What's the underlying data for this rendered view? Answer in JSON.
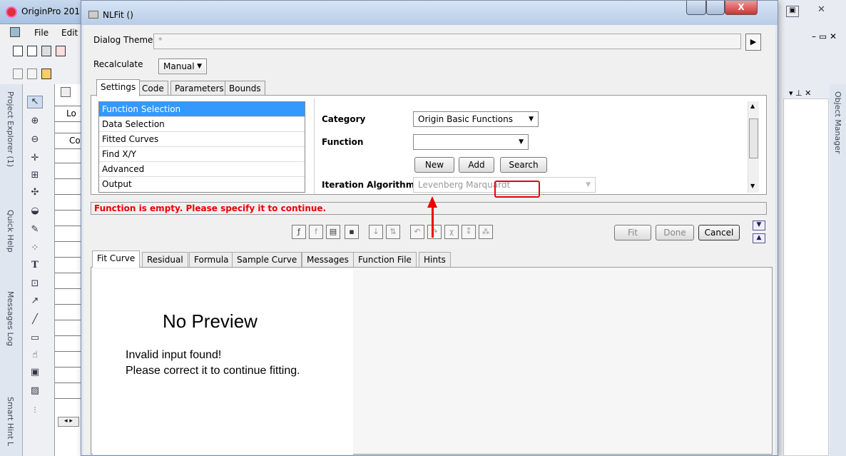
{
  "background_app": {
    "title": "OriginPro 201",
    "menu": [
      "File",
      "Edit"
    ],
    "side_tabs_left": [
      "Project Explorer (1)",
      "Quick Help",
      "Messages Log",
      "Smart Hint L"
    ],
    "side_tabs_right": [
      "Object Manager"
    ],
    "sheet_labels": [
      "Lo",
      "Co"
    ]
  },
  "dialog": {
    "title": "NLFit ()",
    "close_glyph": "X",
    "theme_label": "Dialog Theme",
    "theme_value": "*",
    "recalculate_label": "Recalculate",
    "recalculate_value": "Manual",
    "tabs": [
      "Settings",
      "Code",
      "Parameters",
      "Bounds"
    ],
    "nav_items": [
      "Function Selection",
      "Data Selection",
      "Fitted Curves",
      "Find X/Y",
      "Advanced",
      "Output"
    ],
    "selected_nav": "Function Selection",
    "category_label": "Category",
    "category_value": "Origin Basic Functions",
    "function_label": "Function",
    "function_value": "",
    "new_button": "New",
    "add_button": "Add",
    "search_button": "Search",
    "iteration_label": "Iteration Algorithm",
    "iteration_value": "Levenberg Marquardt",
    "error_message": "Function is empty. Please specify it to continue.",
    "fit_button": "Fit",
    "done_button": "Done",
    "cancel_button": "Cancel",
    "bottom_tabs": [
      "Fit Curve",
      "Residual",
      "Formula",
      "Sample Curve",
      "Messages",
      "Function File",
      "Hints"
    ],
    "preview_title": "No Preview",
    "preview_line1": "Invalid input found!",
    "preview_line2": "Please correct it to continue fitting."
  },
  "colors": {
    "error": "#e00000",
    "selection": "#3399ff",
    "annotation_arrow": "#e00000"
  }
}
